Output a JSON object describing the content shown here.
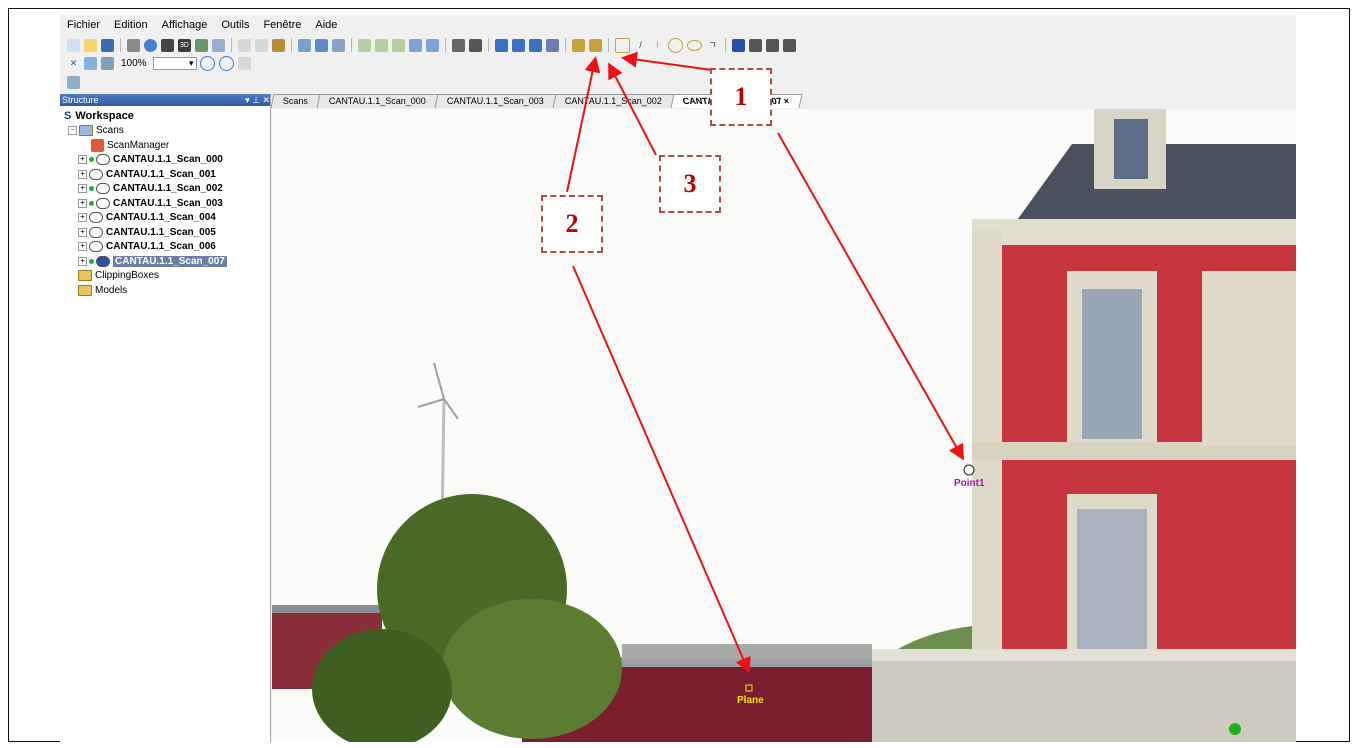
{
  "menu": [
    "Fichier",
    "Edition",
    "Affichage",
    "Outils",
    "Fenêtre",
    "Aide"
  ],
  "toolbar": {
    "zoom_value": "100%"
  },
  "structure_panel": {
    "title": "Structure",
    "controls": "▾ ⊥ ✕",
    "workspace_label": "Workspace",
    "scans_label": "Scans",
    "scanmanager_label": "ScanManager",
    "scans": [
      "CANTAU.1.1_Scan_000",
      "CANTAU.1.1_Scan_001",
      "CANTAU.1.1_Scan_002",
      "CANTAU.1.1_Scan_003",
      "CANTAU.1.1_Scan_004",
      "CANTAU.1.1_Scan_005",
      "CANTAU.1.1_Scan_006",
      "CANTAU.1.1_Scan_007"
    ],
    "clipping_label": "ClippingBoxes",
    "models_label": "Models"
  },
  "tabs": [
    "Scans",
    "CANTAU.1.1_Scan_000",
    "CANTAU.1.1_Scan_003",
    "CANTAU.1.1_Scan_002",
    "CANTAU.1.1_Scan_007"
  ],
  "tab_close": "×",
  "viewport": {
    "point_label": "Point1",
    "plane_label": "Plane",
    "point_color": "#9b1fa0",
    "plane_color": "#f2e600"
  },
  "callouts": [
    "1",
    "2",
    "3"
  ],
  "arrow_color": "#ee1111",
  "brand_icon": "S"
}
